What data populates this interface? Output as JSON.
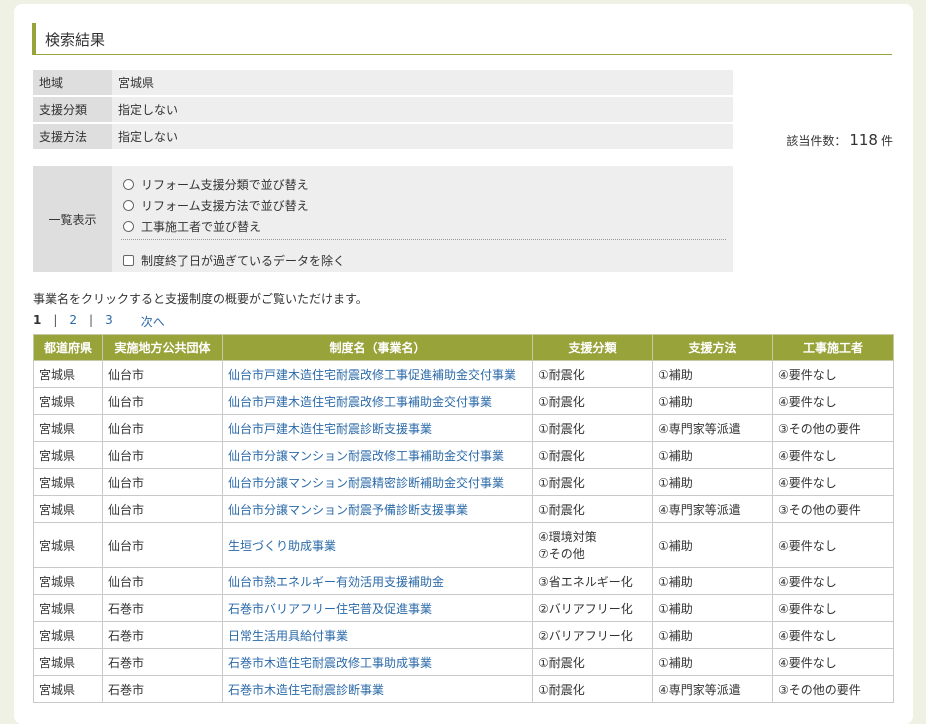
{
  "section_title": "検索結果",
  "conditions": [
    {
      "label": "地域",
      "value": "宮城県"
    },
    {
      "label": "支援分類",
      "value": "指定しない"
    },
    {
      "label": "支援方法",
      "value": "指定しない"
    }
  ],
  "count": {
    "label": "該当件数：",
    "value": "118",
    "unit": "件"
  },
  "list_display": {
    "label": "一覧表示",
    "options": [
      "リフォーム支援分類で並び替え",
      "リフォーム支援方法で並び替え",
      "工事施工者で並び替え"
    ],
    "exclude_label": "制度終了日が過ぎているデータを除く"
  },
  "note": "事業名をクリックすると支援制度の概要がご覧いただけます。",
  "pager": {
    "current": "1",
    "sep": "|",
    "p2": "2",
    "p3": "3",
    "next": "次へ"
  },
  "columns": [
    "都道府県",
    "実施地方公共団体",
    "制度名（事業名）",
    "支援分類",
    "支援方法",
    "工事施工者"
  ],
  "rows": [
    {
      "pref": "宮城県",
      "city": "仙台市",
      "name": "仙台市戸建木造住宅耐震改修工事促進補助金交付事業",
      "cat": "①耐震化",
      "method": "①補助",
      "builder": "④要件なし"
    },
    {
      "pref": "宮城県",
      "city": "仙台市",
      "name": "仙台市戸建木造住宅耐震改修工事補助金交付事業",
      "cat": "①耐震化",
      "method": "①補助",
      "builder": "④要件なし"
    },
    {
      "pref": "宮城県",
      "city": "仙台市",
      "name": "仙台市戸建木造住宅耐震診断支援事業",
      "cat": "①耐震化",
      "method": "④専門家等派遣",
      "builder": "③その他の要件"
    },
    {
      "pref": "宮城県",
      "city": "仙台市",
      "name": "仙台市分譲マンション耐震改修工事補助金交付事業",
      "cat": "①耐震化",
      "method": "①補助",
      "builder": "④要件なし"
    },
    {
      "pref": "宮城県",
      "city": "仙台市",
      "name": "仙台市分譲マンション耐震精密診断補助金交付事業",
      "cat": "①耐震化",
      "method": "①補助",
      "builder": "④要件なし"
    },
    {
      "pref": "宮城県",
      "city": "仙台市",
      "name": "仙台市分譲マンション耐震予備診断支援事業",
      "cat": "①耐震化",
      "method": "④専門家等派遣",
      "builder": "③その他の要件"
    },
    {
      "pref": "宮城県",
      "city": "仙台市",
      "name": "生垣づくり助成事業",
      "cat": "④環境対策",
      "cat2": "⑦その他",
      "method": "①補助",
      "builder": "④要件なし"
    },
    {
      "pref": "宮城県",
      "city": "仙台市",
      "name": "仙台市熱エネルギー有効活用支援補助金",
      "cat": "③省エネルギー化",
      "method": "①補助",
      "builder": "④要件なし"
    },
    {
      "pref": "宮城県",
      "city": "石巻市",
      "name": "石巻市バリアフリー住宅普及促進事業",
      "cat": "②バリアフリー化",
      "method": "①補助",
      "builder": "④要件なし"
    },
    {
      "pref": "宮城県",
      "city": "石巻市",
      "name": "日常生活用具給付事業",
      "cat": "②バリアフリー化",
      "method": "①補助",
      "builder": "④要件なし"
    },
    {
      "pref": "宮城県",
      "city": "石巻市",
      "name": "石巻市木造住宅耐震改修工事助成事業",
      "cat": "①耐震化",
      "method": "①補助",
      "builder": "④要件なし"
    },
    {
      "pref": "宮城県",
      "city": "石巻市",
      "name": "石巻市木造住宅耐震診断事業",
      "cat": "①耐震化",
      "method": "④専門家等派遣",
      "builder": "③その他の要件"
    }
  ]
}
